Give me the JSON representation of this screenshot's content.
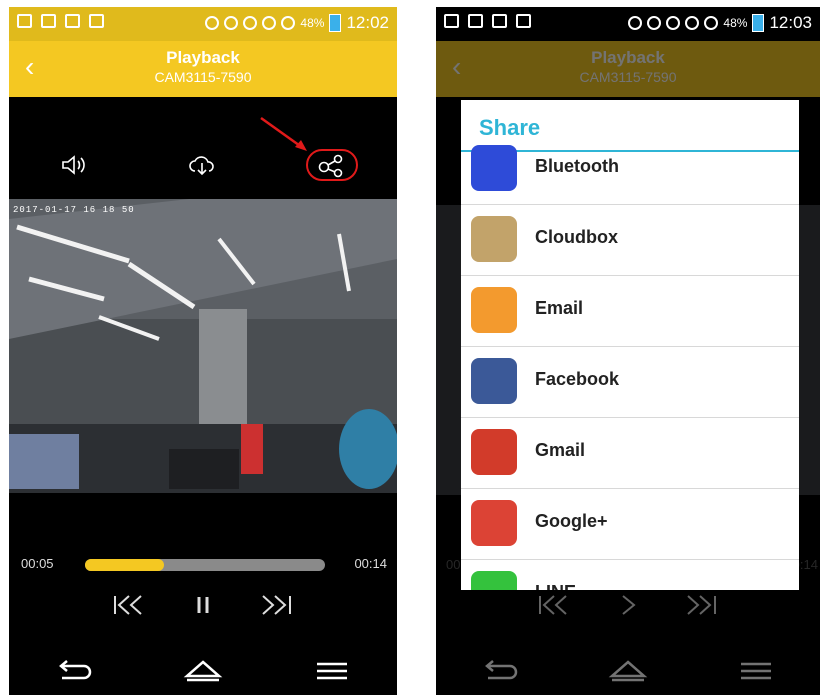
{
  "status_bar_left": {
    "time": "12:02",
    "battery": "48%"
  },
  "status_bar_right": {
    "time": "12:03",
    "battery": "48%"
  },
  "header": {
    "title": "Playback",
    "subtitle": "CAM3115-7590"
  },
  "video": {
    "timestamp": "2017-01-17 16 18 50"
  },
  "progress": {
    "elapsed": "00:05",
    "total": "00:14",
    "fraction": 0.33
  },
  "share_dialog": {
    "title": "Share",
    "items": [
      {
        "label": "Bluetooth",
        "icon": "bluetooth-icon",
        "color": "#2e4bd8"
      },
      {
        "label": "Cloudbox",
        "icon": "cloudbox-icon",
        "color": "#c2a36a"
      },
      {
        "label": "Email",
        "icon": "email-icon",
        "color": "#f39a2e"
      },
      {
        "label": "Facebook",
        "icon": "facebook-icon",
        "color": "#3b5998"
      },
      {
        "label": "Gmail",
        "icon": "gmail-icon",
        "color": "#d23b2a"
      },
      {
        "label": "Google+",
        "icon": "google-plus-icon",
        "color": "#dc4335"
      },
      {
        "label": "LINE",
        "icon": "line-icon",
        "color": "#34c23d"
      }
    ]
  },
  "colors": {
    "header_yellow": "#f4c822",
    "accent_blue": "#2fb5d6",
    "highlight_red": "#e01a1a"
  }
}
